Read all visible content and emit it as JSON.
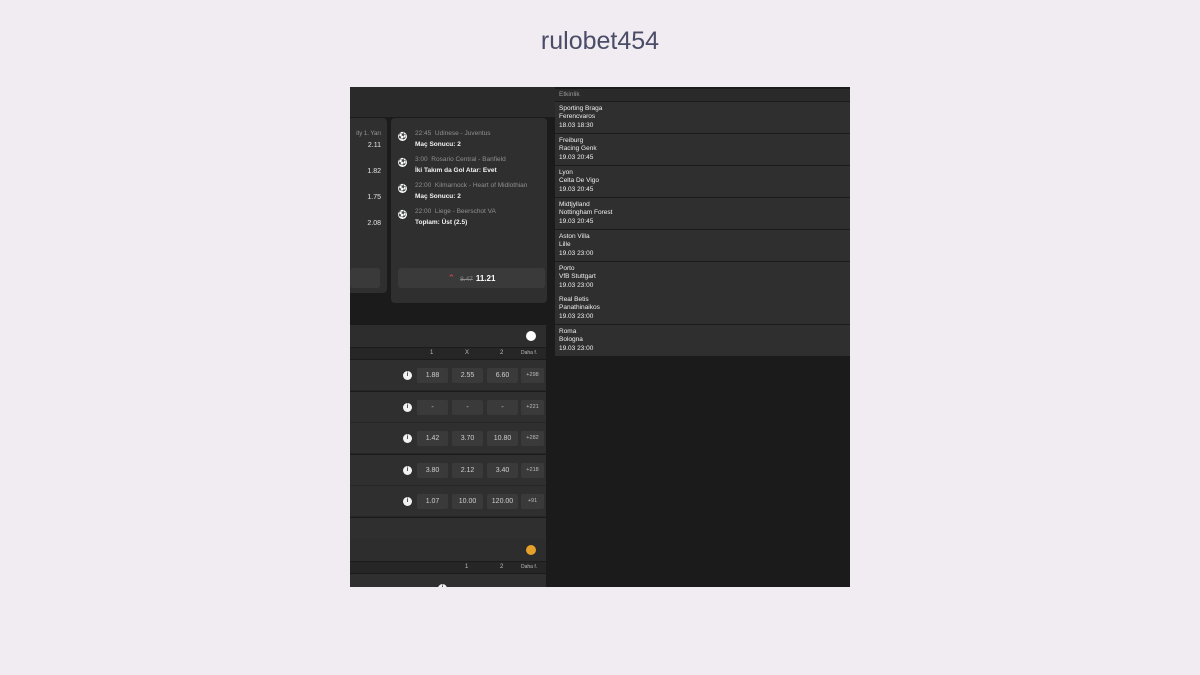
{
  "page": {
    "title": "rulobet454"
  },
  "left_card": {
    "header": "ity 1. Yarı",
    "odds": [
      "2.11",
      "1.82",
      "1.75",
      "2.08"
    ]
  },
  "coupon": {
    "bets": [
      {
        "time": "22:45",
        "match": "Udinese - Juventus",
        "selection": "Maç Sonucu: 2"
      },
      {
        "time": "3:00",
        "match": "Rosario Central - Banfield",
        "selection": "İki Takım da Gol Atar: Evet"
      },
      {
        "time": "22:00",
        "match": "Kilmarnock - Heart of Midlothian",
        "selection": "Maç Sonucu: 2"
      },
      {
        "time": "22:00",
        "match": "Liege - Beerschot VA",
        "selection": "Toplam: Üst (2.5)"
      }
    ],
    "old_odds": "8.47",
    "new_odds": "11.21"
  },
  "football": {
    "columns": [
      "1",
      "X",
      "2",
      "Daha f."
    ],
    "rows": [
      {
        "o1": "1.88",
        "ox": "2.55",
        "o2": "6.60",
        "more": "+298"
      },
      {
        "o1": "-",
        "ox": "-",
        "o2": "-",
        "more": "+221"
      },
      {
        "o1": "1.42",
        "ox": "3.70",
        "o2": "10.80",
        "more": "+282"
      },
      {
        "o1": "3.80",
        "ox": "2.12",
        "o2": "3.40",
        "more": "+218"
      },
      {
        "o1": "1.07",
        "ox": "10.00",
        "o2": "120.00",
        "more": "+91"
      }
    ]
  },
  "basketball": {
    "columns": [
      "1",
      "2",
      "Daha f."
    ]
  },
  "events": {
    "header": "Etkinlik",
    "items": [
      {
        "home": "Sporting Braga",
        "away": "Ferencvaros",
        "datetime": "18.03 18:30"
      },
      {
        "home": "Freiburg",
        "away": "Racing Genk",
        "datetime": "19.03 20:45"
      },
      {
        "home": "Lyon",
        "away": "Celta De Vigo",
        "datetime": "19.03 20:45"
      },
      {
        "home": "Midtjylland",
        "away": "Nottingham Forest",
        "datetime": "19.03 20:45"
      },
      {
        "home": "Aston Villa",
        "away": "Lille",
        "datetime": "19.03 23:00"
      },
      {
        "home": "Porto",
        "away": "VfB Stuttgart",
        "datetime": "19.03 23:00"
      },
      {
        "home": "Real Betis",
        "away": "Panathinaikos",
        "datetime": "19.03 23:00"
      },
      {
        "home": "Roma",
        "away": "Bologna",
        "datetime": "19.03 23:00"
      }
    ]
  }
}
